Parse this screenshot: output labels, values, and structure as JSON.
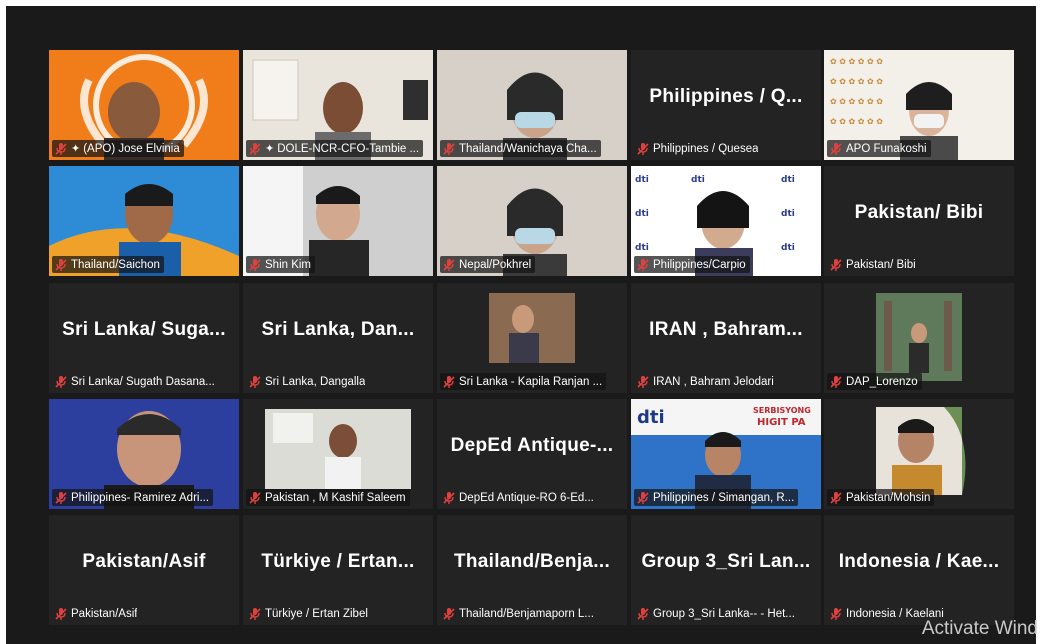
{
  "watermark": "Activate Wind",
  "colors": {
    "active_border": "#b7d84a",
    "tile_bg": "#232323",
    "mic_muted": "#e0413e"
  },
  "tiles": [
    {
      "label": "(APO) Jose Elvinia",
      "big": "",
      "pinned": true,
      "bg": "orange"
    },
    {
      "label": "DOLE-NCR-CFO-Tambie ...",
      "big": "",
      "pinned": true,
      "active": true,
      "bg": "room"
    },
    {
      "label": "Thailand/Wanichaya Cha...",
      "big": "",
      "bg": "light"
    },
    {
      "label": "Philippines / Quesea",
      "big": "Philippines / Q...",
      "bg": "dark"
    },
    {
      "label": "APO Funakoshi",
      "big": "",
      "bg": "logo"
    },
    {
      "label": "Thailand/Saichon",
      "big": "",
      "bg": "blue"
    },
    {
      "label": "Shin Kim",
      "big": "",
      "bg": "grey"
    },
    {
      "label": "Nepal/Pokhrel",
      "big": "",
      "bg": "light"
    },
    {
      "label": "Philippines/Carpio",
      "big": "",
      "bg": "dti"
    },
    {
      "label": "Pakistan/ Bibi",
      "big": "Pakistan/ Bibi",
      "bg": "dark"
    },
    {
      "label": "Sri Lanka/ Sugath Dasana...",
      "big": "Sri Lanka/ Suga...",
      "bg": "dark"
    },
    {
      "label": "Sri Lanka,  Dangalla",
      "big": "Sri Lanka,  Dan...",
      "bg": "dark"
    },
    {
      "label": "Sri Lanka - Kapila Ranjan ...",
      "big": "",
      "bg": "smallcam"
    },
    {
      "label": "IRAN , Bahram Jelodari",
      "big": "IRAN , Bahram...",
      "bg": "dark"
    },
    {
      "label": "DAP_Lorenzo",
      "big": "",
      "bg": "smallcam2"
    },
    {
      "label": "Philippines- Ramirez Adri...",
      "big": "",
      "bg": "blue2"
    },
    {
      "label": "Pakistan , M Kashif Saleem",
      "big": "",
      "bg": "office"
    },
    {
      "label": "DepEd Antique-RO 6-Ed...",
      "big": "DepEd Antique-...",
      "bg": "dark"
    },
    {
      "label": "Philippines / Simangan, R...",
      "big": "",
      "bg": "dti2"
    },
    {
      "label": "Pakistan/Mohsin",
      "big": "",
      "bg": "smallcam3"
    },
    {
      "label": "Pakistan/Asif",
      "big": "Pakistan/Asif",
      "bg": "dark"
    },
    {
      "label": "Türkiye / Ertan Zibel",
      "big": "Türkiye / Ertan...",
      "bg": "dark"
    },
    {
      "label": "Thailand/Benjamaporn L...",
      "big": "Thailand/Benja...",
      "bg": "dark"
    },
    {
      "label": "Group 3_Sri Lanka-- - Het...",
      "big": "Group 3_Sri Lan...",
      "bg": "dark"
    },
    {
      "label": "Indonesia / Kaelani",
      "big": "Indonesia / Kae...",
      "bg": "dark"
    }
  ]
}
